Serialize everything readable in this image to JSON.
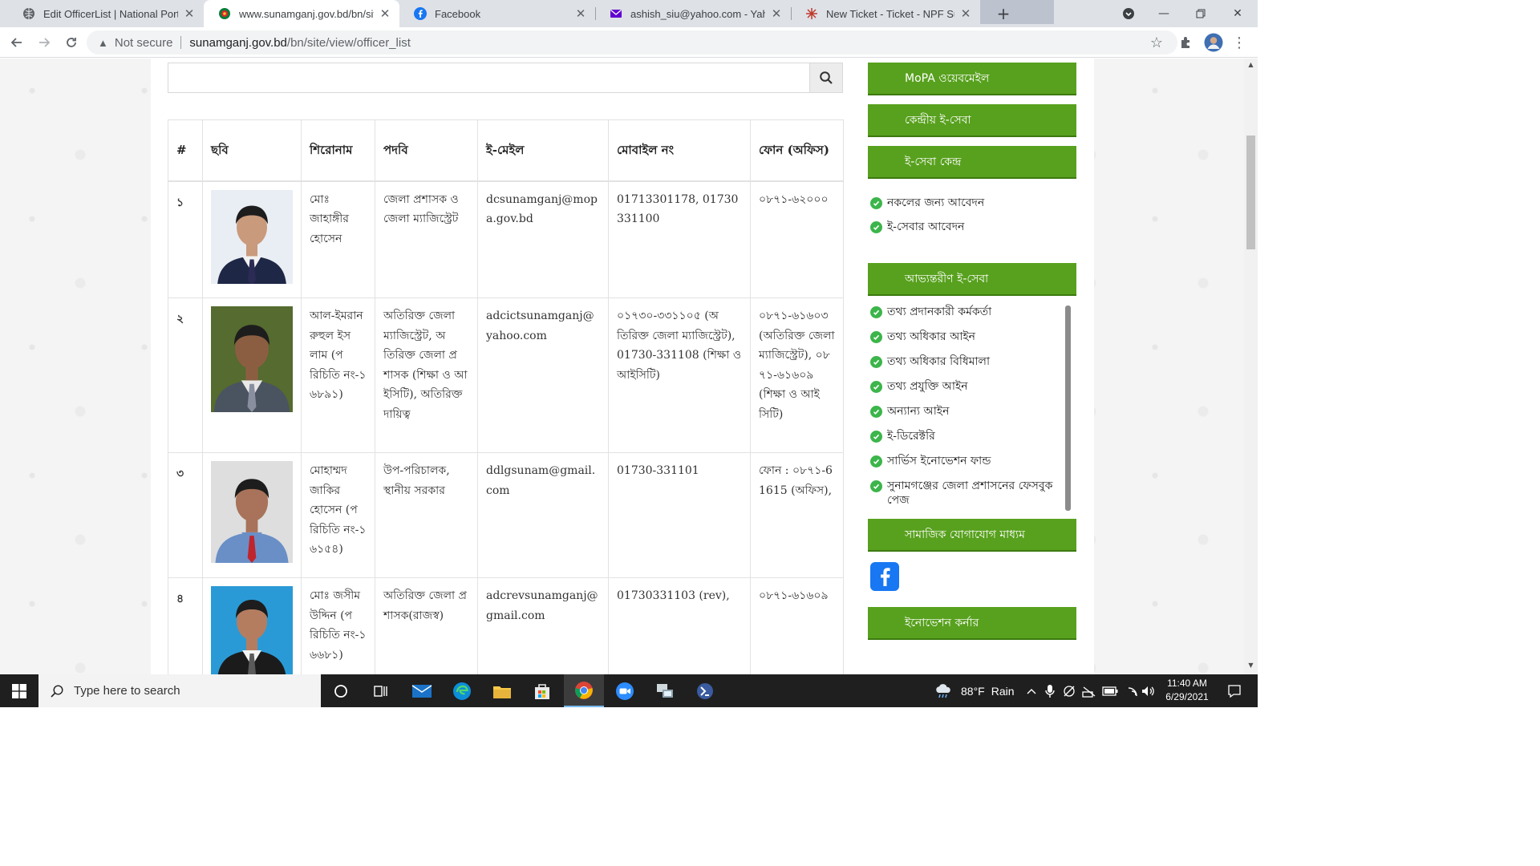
{
  "browser": {
    "tabs": [
      {
        "title": "Edit OfficerList | National Portal",
        "icon": "portal-icon",
        "active": false
      },
      {
        "title": "www.sunamganj.gov.bd/bn/site/",
        "icon": "bd-emblem-icon",
        "active": true
      },
      {
        "title": "Facebook",
        "icon": "facebook-icon",
        "active": false
      },
      {
        "title": "ashish_siu@yahoo.com - Yahoo M",
        "icon": "yahoo-mail-icon",
        "active": false
      },
      {
        "title": "New Ticket - Ticket - NPF Suppo",
        "icon": "npf-icon",
        "active": false
      }
    ],
    "address": {
      "security": "Not secure",
      "domain": "sunamganj.gov.bd",
      "path": "/bn/site/view/officer_list"
    }
  },
  "search": {
    "placeholder": "",
    "value": ""
  },
  "table": {
    "headers": [
      "#",
      "ছবি",
      "শিরোনাম",
      "পদবি",
      "ই-মেইল",
      "মোবাইল নং",
      "ফোন (অফিস)"
    ],
    "rows": [
      {
        "num": "১",
        "name": "মোঃ জাহাঙ্গীর হোসেন",
        "designation": "জেলা প্রশাসক ও জেলা ম্যাজিস্ট্রেট",
        "email": "dcsunamganj@mopa.gov.bd",
        "mobile": "01713301178, 01730331100",
        "phone": "০৮৭১-৬২০০০",
        "photo": {
          "bg": "#e9eef4",
          "suit": "#1f2747",
          "shirt": "#f2f2f2",
          "tie": "#2b2b55",
          "skin": "#c99a7c"
        }
      },
      {
        "num": "২",
        "name": "আল-ইমরান রুহুল ইসলাম (পরিচিতি নং-১৬৮৯১)",
        "designation": "অতিরিক্ত জেলা ম্যাজিস্ট্রেট, অতিরিক্ত জেলা প্রশাসক (শিক্ষা ও আইসিটি), অতিরিক্ত দায়িত্ব",
        "email": "adcictsunamganj@yahoo.com",
        "mobile": "০১৭৩০-৩৩১১০৫ (অতিরিক্ত জেলা ম্যাজিস্ট্রেট), 01730-331108 (শিক্ষা ও আইসিটি)",
        "phone": "০৮৭১-৬১৬০৩ (অতিরিক্ত জেলা ম্যাজিস্ট্রেট), ০৮৭১-৬১৬০৯ (শিক্ষা ও আইসিটি)",
        "photo": {
          "bg": "#556b2f",
          "suit": "#4a5360",
          "shirt": "#e8e8e8",
          "tie": "#8a8fa0",
          "skin": "#8b5e42"
        }
      },
      {
        "num": "৩",
        "name": "মোহাম্মদ জাকির হোসেন (পরিচিতি নং-১৬১৫৪)",
        "designation": "উপ-পরিচালক, স্থানীয় সরকার",
        "email": "ddlgsunam@gmail.com",
        "mobile": "01730-331101",
        "phone": "ফোন : ০৮৭১-61615 (অফিস),",
        "photo": {
          "bg": "#dedede",
          "suit": "#6a8fc7",
          "shirt": "#6a8fc7",
          "tie": "#c0242d",
          "skin": "#a8735a"
        }
      },
      {
        "num": "৪",
        "name": "মোঃ জসীম উদ্দিন (পরিচিতি নং-১৬৬৮১)",
        "designation": "অতিরিক্ত জেলা প্রশাসক(রাজস্ব)",
        "email": "adcrevsunamganj@gmail.com",
        "mobile": "01730331103 (rev),",
        "phone": "০৮৭১-৬১৬০৯",
        "photo": {
          "bg": "#2a9ad6",
          "suit": "#1b1b1b",
          "shirt": "#f4f4f4",
          "tie": "#5a5a5a",
          "skin": "#b57d60"
        }
      }
    ]
  },
  "sidebar": {
    "mopa_webmail": "MoPA ওয়েবমেইল",
    "central_eservice": "কেন্দ্রীয় ই-সেবা",
    "eservice_center": "ই-সেবা কেন্দ্র",
    "eservice_links": [
      "নকলের জন্য আবেদন",
      "ই-সেবার আবেদন"
    ],
    "internal_eservice": "আভ্যন্তরীণ ই-সেবা",
    "internal_links": [
      "তথ্য প্রদানকারী কর্মকর্তা",
      "তথ্য অধিকার আইন",
      "তথ্য অধিকার বিধিমালা",
      "তথ্য প্রযুক্তি আইন",
      "অন্যান্য আইন",
      "ই-ডিরেক্টরি",
      "সার্ভিস ইনোভেশন ফান্ড",
      "সুনামগঞ্জের জেলা প্রশাসনের ফেসবুক পেজ"
    ],
    "social_media": "সামাজিক যোগাযোগ মাধ্যম",
    "innovation_corner": "ইনোভেশন কর্নার",
    "button_color": "#58a11e"
  },
  "taskbar": {
    "search_placeholder": "Type here to search",
    "weather_temp": "88°F",
    "weather_desc": "Rain",
    "time": "11:40 AM",
    "date": "6/29/2021"
  }
}
